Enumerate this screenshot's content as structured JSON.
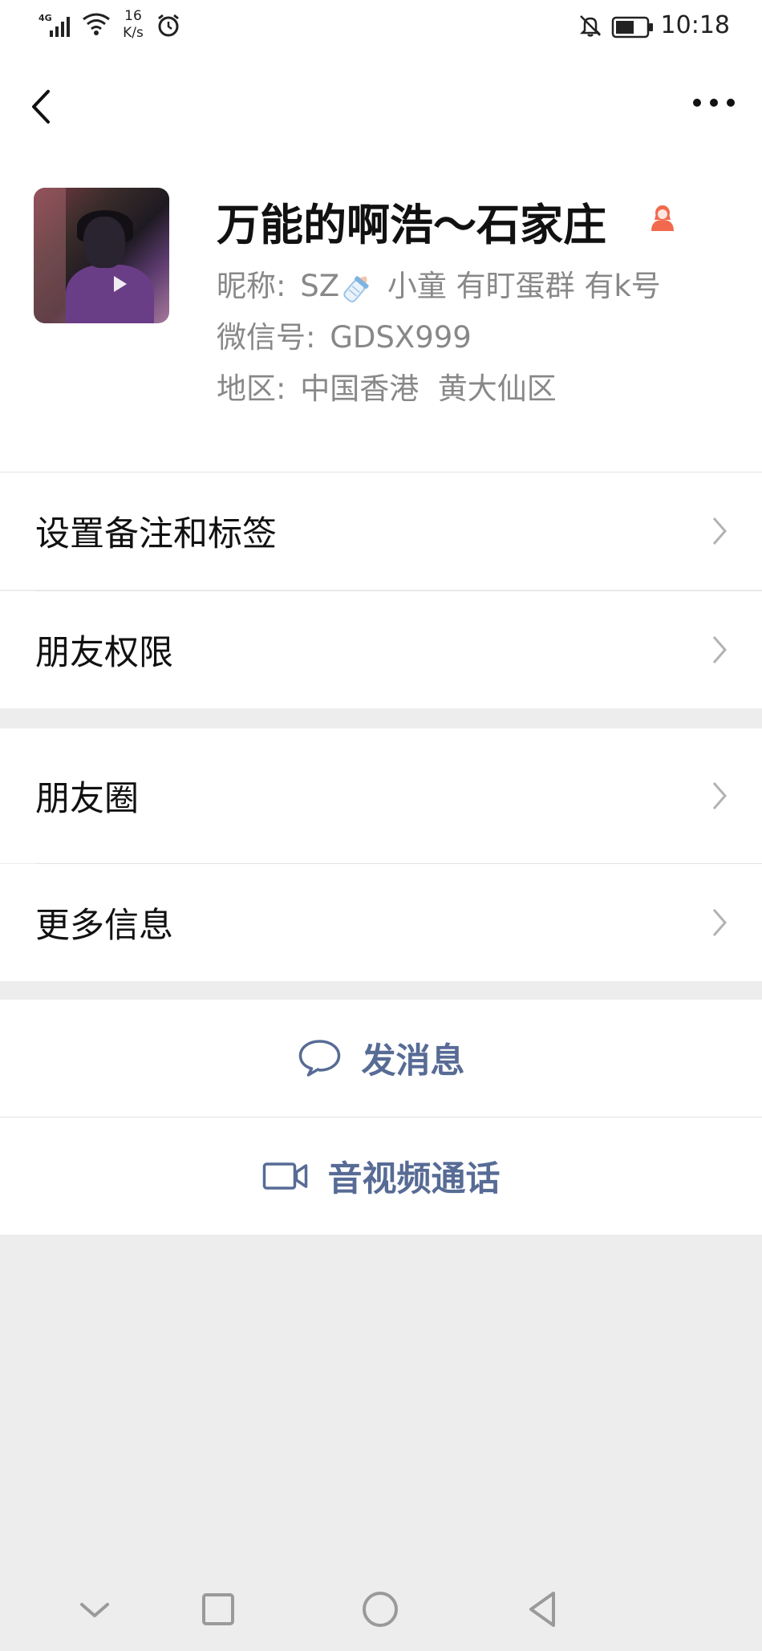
{
  "status_bar": {
    "network": "4G",
    "speed_value": "16",
    "speed_unit": "K/s",
    "time": "10:18"
  },
  "profile": {
    "display_name": "万能的啊浩～石家庄",
    "nickname_label": "昵称:",
    "nickname_prefix": "SZ",
    "nickname_suffix": " 小童 有盯蛋群 有k号",
    "wechat_id_label": "微信号:",
    "wechat_id": "GDSX999",
    "region_label": "地区:",
    "region": "中国香港  黄大仙区"
  },
  "menu": {
    "remark_tags": "设置备注和标签",
    "friend_permissions": "朋友权限",
    "moments": "朋友圈",
    "more_info": "更多信息"
  },
  "actions": {
    "send_message": "发消息",
    "video_call": "音视频通话"
  },
  "colors": {
    "link_blue": "#576b95",
    "background": "#ededed",
    "gender_female": "#f26a4e"
  }
}
